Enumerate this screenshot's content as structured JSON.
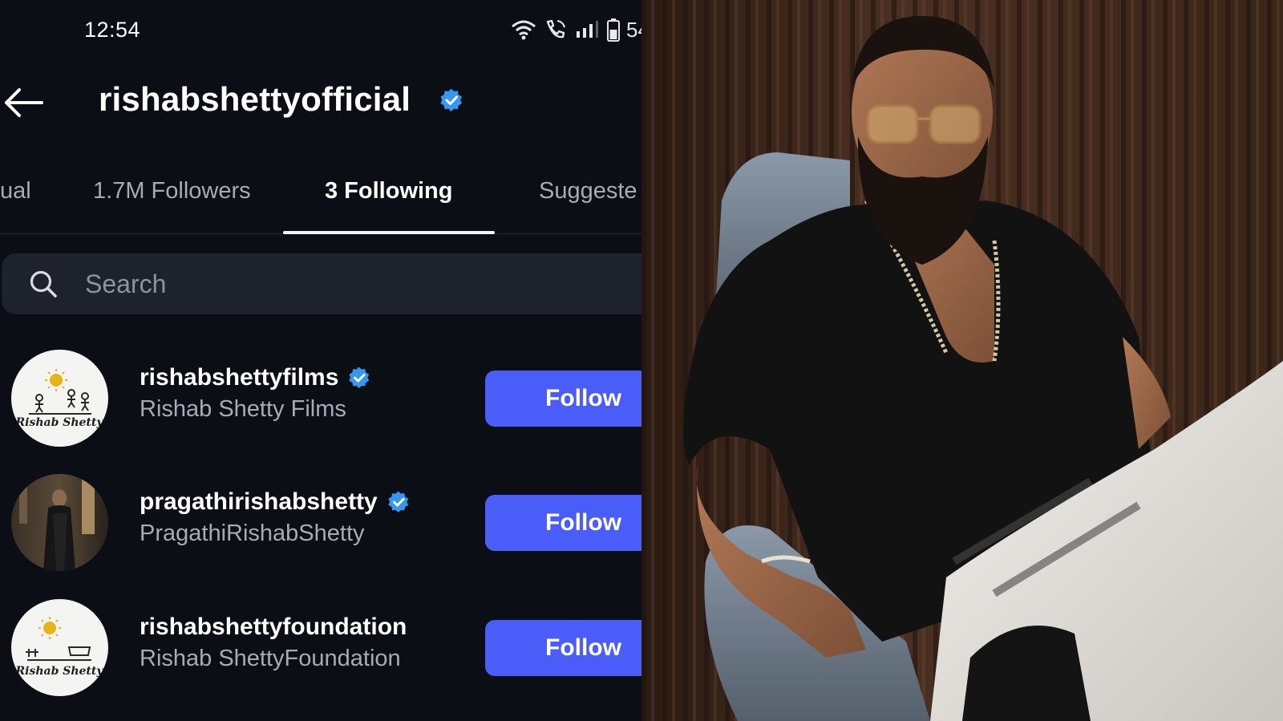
{
  "status_bar": {
    "time": "12:54",
    "battery_percent": "54",
    "icons": [
      "wifi-icon",
      "wifi-call-icon",
      "signal-bars-icon",
      "battery-icon"
    ]
  },
  "header": {
    "back_icon": "arrow-left-icon",
    "profile_name": "rishabshettyofficial",
    "verified": true
  },
  "tabs": [
    {
      "label": "ual",
      "active": false
    },
    {
      "label": "1.7M Followers",
      "active": false
    },
    {
      "label": "3 Following",
      "active": true
    },
    {
      "label": "Suggeste",
      "active": false
    }
  ],
  "search": {
    "placeholder": "Search",
    "value": ""
  },
  "following": [
    {
      "handle": "rishabshettyfilms",
      "name": "Rishab Shetty Films",
      "verified": true,
      "button": "Follow",
      "avatar_text": "Rishab Shetty"
    },
    {
      "handle": "pragathirishabshetty",
      "name": "PragathiRishabShetty",
      "verified": true,
      "button": "Follow"
    },
    {
      "handle": "rishabshettyfoundation",
      "name": "Rishab ShettyFoundation",
      "verified": false,
      "button": "Follow",
      "avatar_text": "Rishab Shetty"
    }
  ],
  "colors": {
    "background": "#0b0e15",
    "follow_button": "#4a5df9",
    "verified_badge": "#3797f0",
    "search_bg": "#1d222c"
  }
}
